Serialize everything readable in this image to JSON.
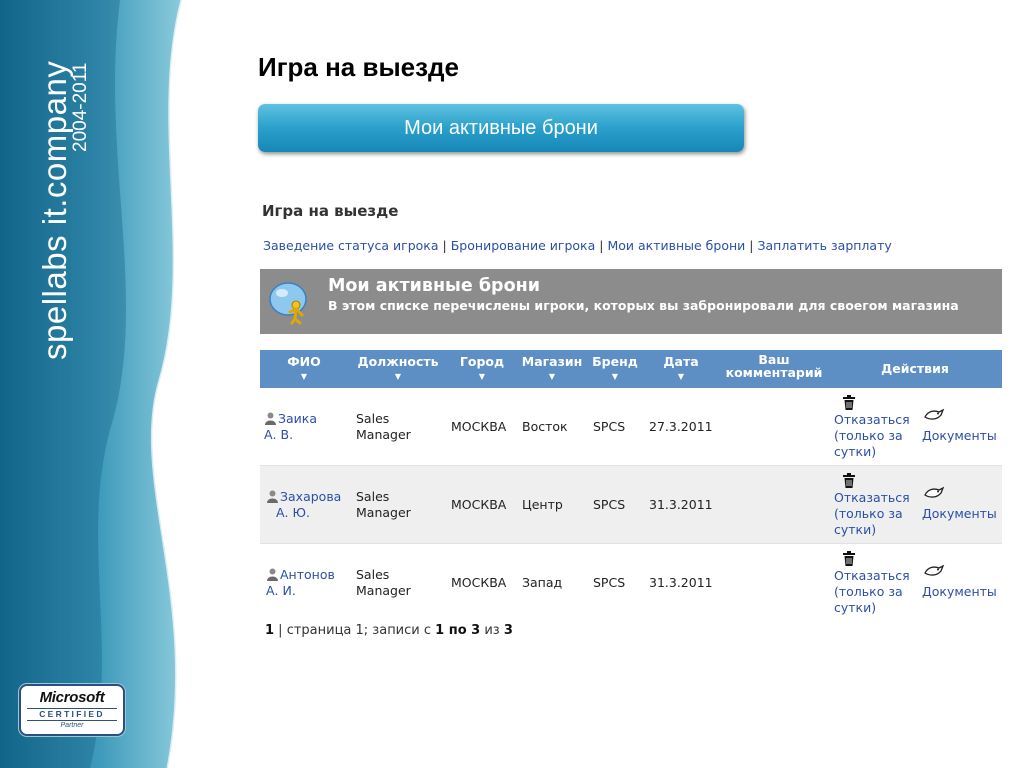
{
  "side": {
    "brand": "spellabs it.company",
    "years": "2004-2011",
    "logo": {
      "name": "Microsoft",
      "certified": "CERTIFIED",
      "partner": "Partner"
    }
  },
  "slide": {
    "title": "Игра на выезде",
    "banner": "Мои активные брони"
  },
  "page": {
    "heading": "Игра на выезде",
    "nav": [
      "Заведение статуса игрока",
      "Бронирование игрока",
      "Мои активные брони",
      "Заплатить зарплату"
    ],
    "nav_separator": "|",
    "panel": {
      "title": "Мои активные брони",
      "description": "В этом списке перечислены игроки, которых вы забронировали для своегом магазина"
    },
    "table": {
      "headers": {
        "fio": "ФИО",
        "position": "Должность",
        "city": "Город",
        "store": "Магазин",
        "brand": "Бренд",
        "date": "Дата",
        "comment": "Ваш комментарий",
        "actions": "Действия"
      },
      "sort_arrow": "▼",
      "rows": [
        {
          "fio1": "Заика",
          "fio2": "А. В.",
          "pos1": "Sales",
          "pos2": "Manager",
          "city": "МОСКВА",
          "store": "Восток",
          "brand": "SPCS",
          "date": "27.3.2011",
          "comment": ""
        },
        {
          "fio1": "Захарова",
          "fio2": "А. Ю.",
          "pos1": "Sales",
          "pos2": "Manager",
          "city": "МОСКВА",
          "store": "Центр",
          "brand": "SPCS",
          "date": "31.3.2011",
          "comment": ""
        },
        {
          "fio1": "Антонов",
          "fio2": "А. И.",
          "pos1": "Sales",
          "pos2": "Manager",
          "city": "МОСКВА",
          "store": "Запад",
          "brand": "SPCS",
          "date": "31.3.2011",
          "comment": ""
        }
      ],
      "action_cancel": [
        "Отказаться",
        "(только за",
        "сутки)"
      ],
      "action_docs": "Документы"
    },
    "pager": {
      "page": "1",
      "text1": " | страница 1; записи с ",
      "from_to": "1 по 3",
      "text2": " из ",
      "total": "3"
    }
  },
  "colors": {
    "side_dark": "#1b6f92",
    "side_light": "#7fc3d8",
    "banner": "#2aa0cb",
    "header_row": "#5d8fc4",
    "panel": "#8c8c8c",
    "link": "#2b4fa7"
  }
}
